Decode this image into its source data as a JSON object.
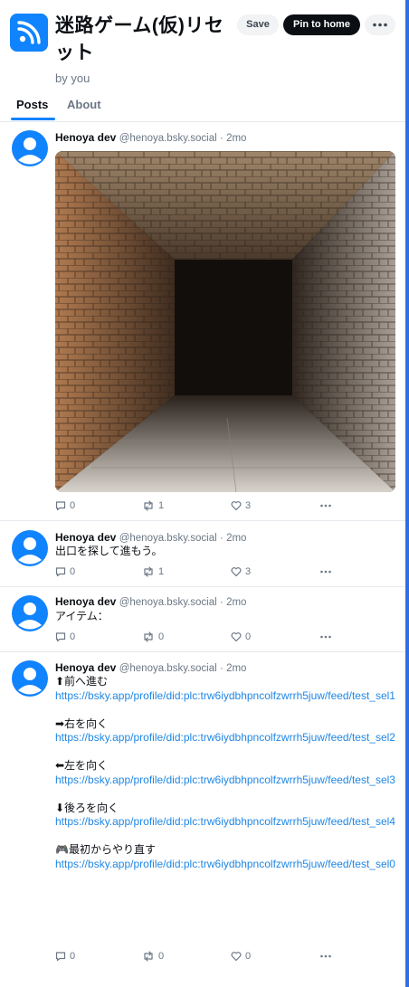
{
  "feed": {
    "title": "迷路ゲーム(仮)リセット",
    "byline": "by you",
    "icon": "feed-icon",
    "accent": "#1083fe"
  },
  "buttons": {
    "save": "Save",
    "pin": "Pin to home",
    "more": "•••"
  },
  "tabs": {
    "posts": "Posts",
    "about": "About"
  },
  "posts": [
    {
      "name": "Henoya dev",
      "handle": "@henoya.bsky.social",
      "time": "2mo",
      "image": "stone-corridor-image",
      "replies": "0",
      "reposts": "1",
      "likes": "3"
    },
    {
      "name": "Henoya dev",
      "handle": "@henoya.bsky.social",
      "time": "2mo",
      "text": "出口を探して進もう。",
      "replies": "0",
      "reposts": "1",
      "likes": "3"
    },
    {
      "name": "Henoya dev",
      "handle": "@henoya.bsky.social",
      "time": "2mo",
      "text": "アイテム：",
      "replies": "0",
      "reposts": "0",
      "likes": "0"
    },
    {
      "name": "Henoya dev",
      "handle": "@henoya.bsky.social",
      "time": "2mo",
      "lines": [
        {
          "text": "⬆前へ進む",
          "link": "https://bsky.app/profile/did:plc:trw6iydbhpncolfzwrrh5juw/feed/test_sel1"
        },
        {
          "text": "➡右を向く",
          "link": "https://bsky.app/profile/did:plc:trw6iydbhpncolfzwrrh5juw/feed/test_sel2"
        },
        {
          "text": "⬅左を向く",
          "link": "https://bsky.app/profile/did:plc:trw6iydbhpncolfzwrrh5juw/feed/test_sel3"
        },
        {
          "text": "⬇後ろを向く",
          "link": "https://bsky.app/profile/did:plc:trw6iydbhpncolfzwrrh5juw/feed/test_sel4"
        },
        {
          "text": "🎮最初からやり直す",
          "link": "https://bsky.app/profile/did:plc:trw6iydbhpncolfzwrrh5juw/feed/test_sel0"
        }
      ],
      "replies": "0",
      "reposts": "0",
      "likes": "0"
    }
  ]
}
